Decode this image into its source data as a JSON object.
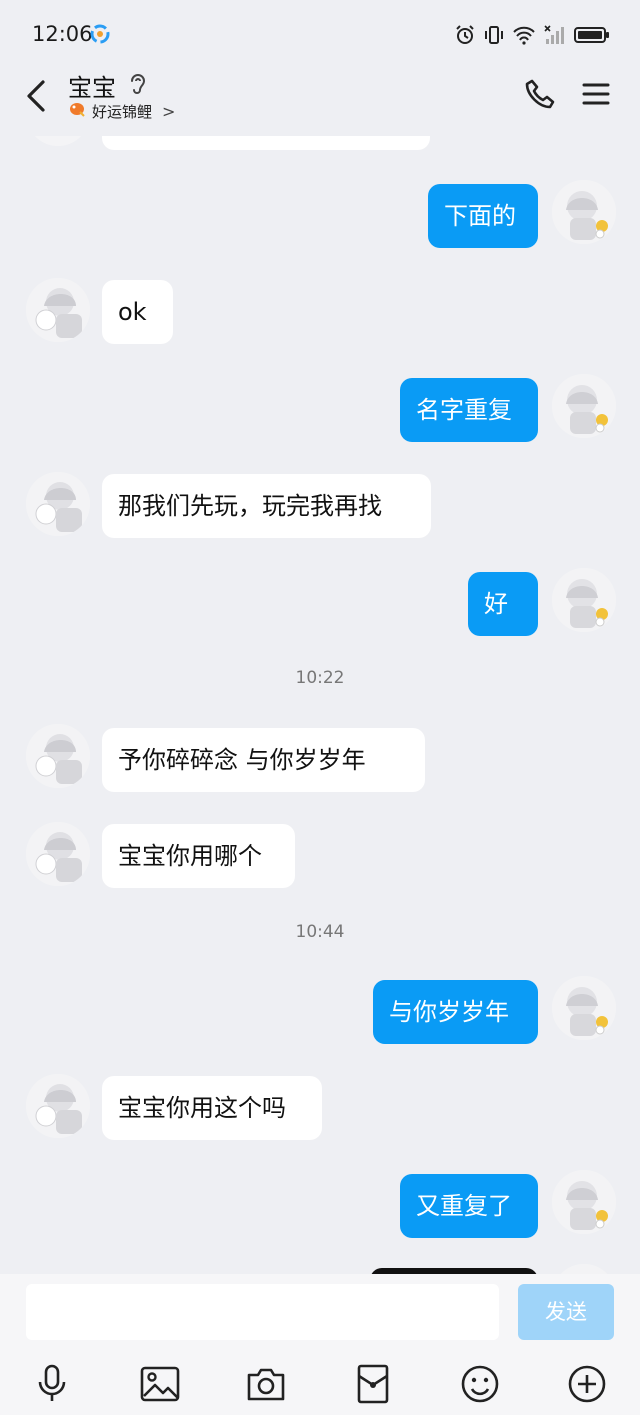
{
  "status_bar": {
    "time": "12:06"
  },
  "header": {
    "title": "宝宝",
    "subtitle": "好运锦鲤",
    "subtitle_chevron": ">"
  },
  "messages": [
    {
      "side": "in",
      "text": "",
      "partial": true
    },
    {
      "side": "out",
      "text": "下面的"
    },
    {
      "side": "in",
      "text": "ok"
    },
    {
      "side": "out",
      "text": "名字重复"
    },
    {
      "side": "in",
      "text": "那我们先玩，玩完我再找"
    },
    {
      "side": "out",
      "text": "好"
    },
    {
      "type": "time",
      "text": "10:22"
    },
    {
      "side": "in",
      "text": "予你碎碎念   与你岁岁年"
    },
    {
      "side": "in",
      "text": "宝宝你用哪个"
    },
    {
      "type": "time",
      "text": "10:44"
    },
    {
      "side": "out",
      "text": "与你岁岁年"
    },
    {
      "side": "in",
      "text": "宝宝你用这个吗"
    },
    {
      "side": "out",
      "text": "又重复了"
    },
    {
      "side": "out",
      "text": "",
      "partial": true
    }
  ],
  "input": {
    "value": "",
    "placeholder": ""
  },
  "send_label": "发送",
  "toolbar": [
    "microphone-icon",
    "image-icon",
    "camera-icon",
    "red-packet-icon",
    "emoji-icon",
    "plus-icon"
  ],
  "colors": {
    "background": "#eeeff3",
    "outgoing_bubble": "#0a9bf5",
    "incoming_bubble": "#ffffff",
    "send_button": "#9fd4f9"
  }
}
